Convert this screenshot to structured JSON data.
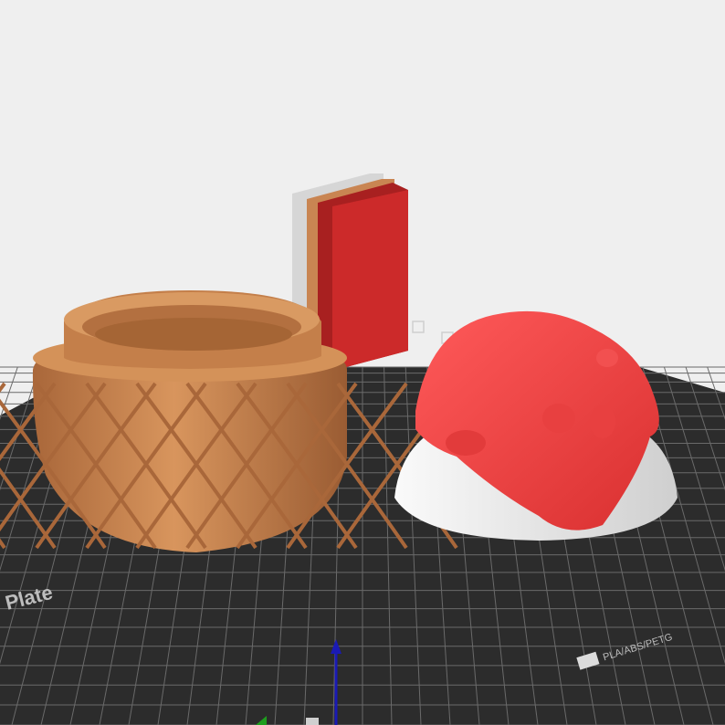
{
  "viewport": {
    "background_color": "#efefef",
    "plate_color": "#2c2c2c",
    "grid_color": "#6a6a6a"
  },
  "plate": {
    "label": "Plate",
    "badge_text": "PLA/ABS/PETG"
  },
  "objects": [
    {
      "name": "pot",
      "color": "#c98552"
    },
    {
      "name": "wipe-tower",
      "colors": [
        "#d6d6d6",
        "#c98552",
        "#cc2a2a"
      ]
    },
    {
      "name": "mushroom-cap",
      "colors": [
        "#f04848",
        "#e6e6e6"
      ]
    }
  ],
  "axes": {
    "z_color": "#1a1ab4",
    "x_color": "#c8281e",
    "y_color": "#1e9e1e"
  },
  "icons": [
    "axis-gizmo-icon"
  ]
}
